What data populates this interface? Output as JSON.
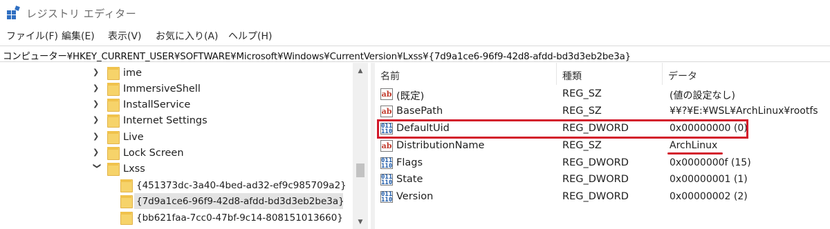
{
  "window": {
    "title": "レジストリ エディター",
    "icon": "registry-editor-icon"
  },
  "menu": [
    "ファイル(F)",
    "編集(E)",
    "表示(V)",
    "お気に入り(A)",
    "ヘルプ(H)"
  ],
  "address": "コンピューター¥HKEY_CURRENT_USER¥SOFTWARE¥Microsoft¥Windows¥CurrentVersion¥Lxss¥{7d9a1ce6-96f9-42d8-afdd-bd3d3eb2be3a}",
  "tree": {
    "items": [
      {
        "label": "ime",
        "expander": "collapsed"
      },
      {
        "label": "ImmersiveShell",
        "expander": "collapsed"
      },
      {
        "label": "InstallService",
        "expander": "collapsed"
      },
      {
        "label": "Internet Settings",
        "expander": "collapsed"
      },
      {
        "label": "Live",
        "expander": "collapsed"
      },
      {
        "label": "Lock Screen",
        "expander": "collapsed"
      },
      {
        "label": "Lxss",
        "expander": "expanded"
      },
      {
        "label": "{451373dc-3a40-4bed-ad32-ef9c985709a2}",
        "expander": "none"
      },
      {
        "label": "{7d9a1ce6-96f9-42d8-afdd-bd3d3eb2be3a}",
        "expander": "none",
        "selected": true
      },
      {
        "label": "{bb621faa-7cc0-47bf-9c14-808151013660}",
        "expander": "none"
      }
    ]
  },
  "list": {
    "columns": {
      "name": "名前",
      "type": "種類",
      "data": "データ"
    },
    "rows": [
      {
        "icon": "ab",
        "name": "(既定)",
        "type": "REG_SZ",
        "data": "(値の設定なし)"
      },
      {
        "icon": "ab",
        "name": "BasePath",
        "type": "REG_SZ",
        "data": "¥¥?¥E:¥WSL¥ArchLinux¥rootfs"
      },
      {
        "icon": "bin",
        "name": "DefaultUid",
        "type": "REG_DWORD",
        "data": "0x00000000 (0)"
      },
      {
        "icon": "ab",
        "name": "DistributionName",
        "type": "REG_SZ",
        "data": "ArchLinux"
      },
      {
        "icon": "bin",
        "name": "Flags",
        "type": "REG_DWORD",
        "data": "0x0000000f (15)"
      },
      {
        "icon": "bin",
        "name": "State",
        "type": "REG_DWORD",
        "data": "0x00000001 (1)"
      },
      {
        "icon": "bin",
        "name": "Version",
        "type": "REG_DWORD",
        "data": "0x00000002 (2)"
      }
    ]
  },
  "colors": {
    "highlight": "#d3182b",
    "folder": "#f6d36a",
    "selection": "#e3e3e3"
  },
  "icon_glyphs": {
    "ab": "ab",
    "bin": "011\n110"
  }
}
